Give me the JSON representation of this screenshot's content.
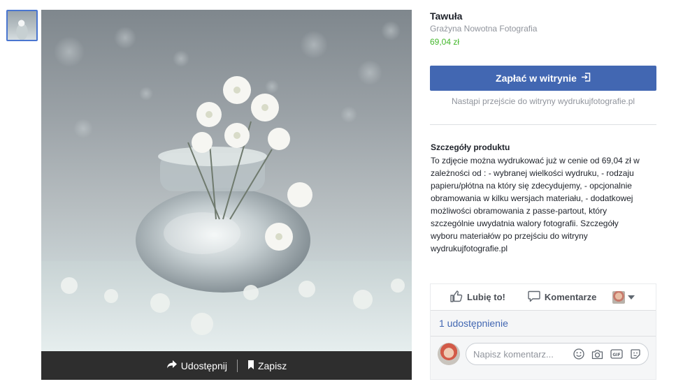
{
  "thumbnail": {
    "alt": "Tawuła"
  },
  "photo_bar": {
    "share_label": "Udostępnij",
    "save_label": "Zapisz"
  },
  "product": {
    "title": "Tawuła",
    "seller": "Grażyna Nowotna Fotografia",
    "price": "69,04 zł"
  },
  "checkout": {
    "button_label": "Zapłać w witrynie",
    "note": "Nastąpi przejście do witryny wydrukujfotografie.pl"
  },
  "details": {
    "heading": "Szczegóły produktu",
    "body": "To zdjęcie można wydrukować już w cenie od 69,04 zł w zależności od : - wybranej wielkości wydruku, - rodzaju papieru/płótna na który się zdecydujemy, - opcjonalnie obramowania w kilku wersjach materiału, - dodatkowej możliwości obramowania z passe-partout, który szczególnie uwydatnia walory fotografii. Szczegóły wyboru materiałów po przejściu do witryny wydrukujfotografie.pl"
  },
  "social": {
    "like_label": "Lubię to!",
    "comment_label": "Komentarze",
    "shares_text": "1 udostępnienie",
    "comment_placeholder": "Napisz komentarz..."
  },
  "icons": {
    "share": "share-arrow-icon",
    "save": "bookmark-icon",
    "external": "external-link-icon",
    "like": "thumbs-up-icon",
    "comment": "speech-bubble-icon",
    "emoji": "smiley-icon",
    "camera": "camera-icon",
    "gif": "gif-icon",
    "sticker": "sticker-icon"
  },
  "colors": {
    "accent": "#4267b2",
    "price": "#42b72a",
    "muted": "#90949c"
  }
}
